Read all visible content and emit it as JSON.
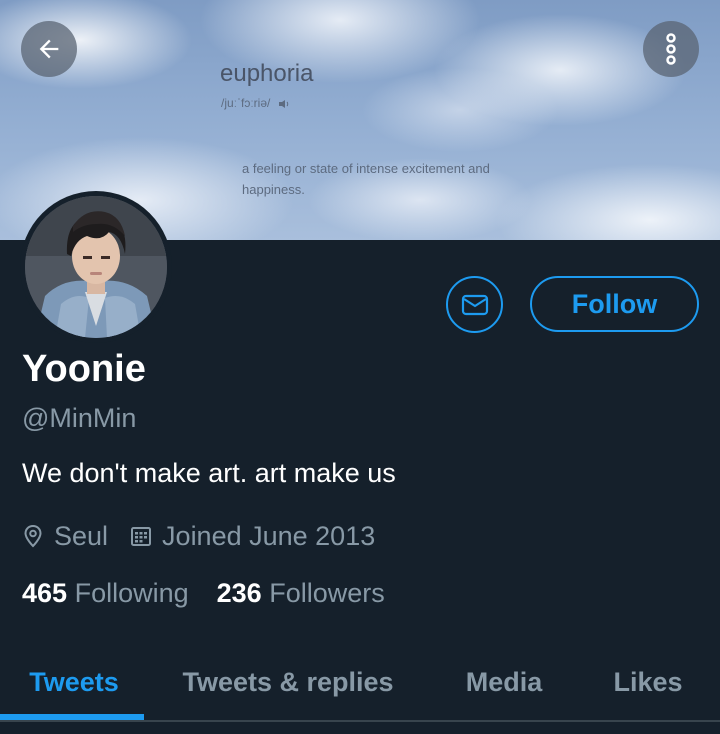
{
  "banner": {
    "word": "euphoria",
    "phonetic": "/juːˈfɔːriə/",
    "definition": "a feeling or state of intense excitement and happiness."
  },
  "icons": {
    "back": "arrow-left-icon",
    "more": "more-vertical-icon",
    "message": "mail-icon",
    "location": "location-pin-icon",
    "calendar": "calendar-icon"
  },
  "profile": {
    "name": "Yoonie",
    "handle": "@MinMin",
    "bio": "We don't make art. art make us",
    "location": "Seul",
    "joined": "Joined June 2013",
    "following_count": "465",
    "following_label": "Following",
    "followers_count": "236",
    "followers_label": "Followers"
  },
  "actions": {
    "follow_label": "Follow"
  },
  "tabs": [
    {
      "label": "Tweets",
      "active": true
    },
    {
      "label": "Tweets & replies",
      "active": false
    },
    {
      "label": "Media",
      "active": false
    },
    {
      "label": "Likes",
      "active": false
    }
  ],
  "colors": {
    "background": "#15202b",
    "accent": "#1d9bf0",
    "secondary_text": "#8899a6"
  }
}
